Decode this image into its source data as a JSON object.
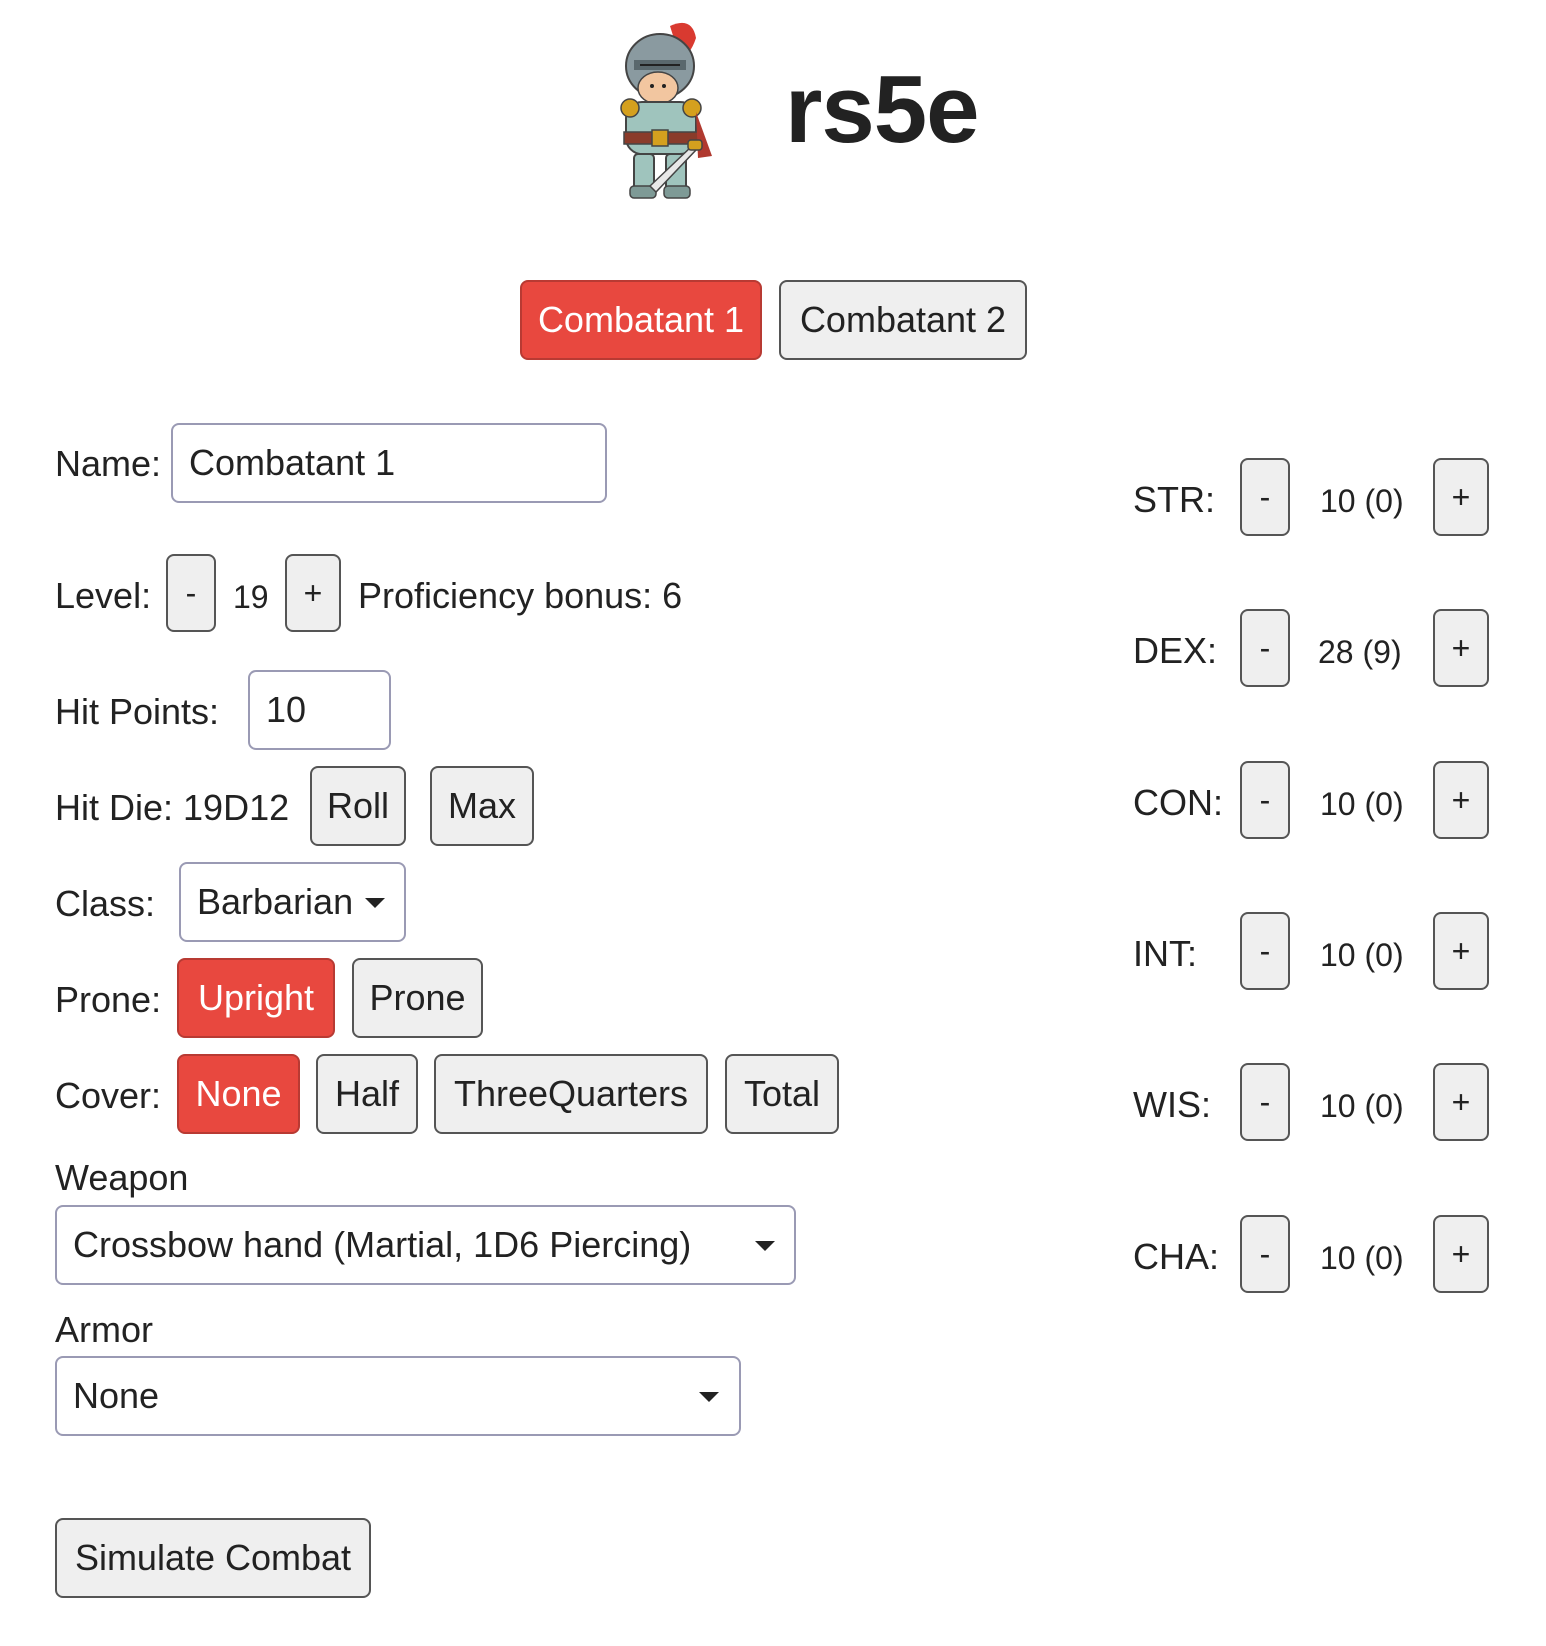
{
  "app": {
    "title": "rs5e"
  },
  "tabs": [
    {
      "label": "Combatant 1",
      "active": true
    },
    {
      "label": "Combatant 2",
      "active": false
    }
  ],
  "form": {
    "name_label": "Name:",
    "name_value": "Combatant 1",
    "level_label": "Level:",
    "level_minus": "-",
    "level_value": "19",
    "level_plus": "+",
    "proficiency_text": "Proficiency bonus: 6",
    "hp_label": "Hit Points:",
    "hp_value": "10",
    "hit_die_text": "Hit Die: 19D12",
    "roll_label": "Roll",
    "max_label": "Max",
    "class_label": "Class:",
    "class_value": "Barbarian",
    "prone_label": "Prone:",
    "prone_options": [
      {
        "label": "Upright",
        "active": true
      },
      {
        "label": "Prone",
        "active": false
      }
    ],
    "cover_label": "Cover:",
    "cover_options": [
      {
        "label": "None",
        "active": true
      },
      {
        "label": "Half",
        "active": false
      },
      {
        "label": "ThreeQuarters",
        "active": false
      },
      {
        "label": "Total",
        "active": false
      }
    ],
    "weapon_label": "Weapon",
    "weapon_value": "Crossbow hand (Martial, 1D6 Piercing)",
    "armor_label": "Armor",
    "armor_value": "None",
    "simulate_label": "Simulate Combat"
  },
  "stats": [
    {
      "label": "STR:",
      "value": "10 (0)",
      "minus": "-",
      "plus": "+"
    },
    {
      "label": "DEX:",
      "value": "28 (9)",
      "minus": "-",
      "plus": "+"
    },
    {
      "label": "CON:",
      "value": "10 (0)",
      "minus": "-",
      "plus": "+"
    },
    {
      "label": "INT:",
      "value": "10 (0)",
      "minus": "-",
      "plus": "+"
    },
    {
      "label": "WIS:",
      "value": "10 (0)",
      "minus": "-",
      "plus": "+"
    },
    {
      "label": "CHA:",
      "value": "10 (0)",
      "minus": "-",
      "plus": "+"
    }
  ],
  "colors": {
    "accent": "#e8483f",
    "button_bg": "#efefef"
  },
  "icons": {
    "logo": "knight-logo-icon",
    "dropdown": "caret-down-icon"
  }
}
